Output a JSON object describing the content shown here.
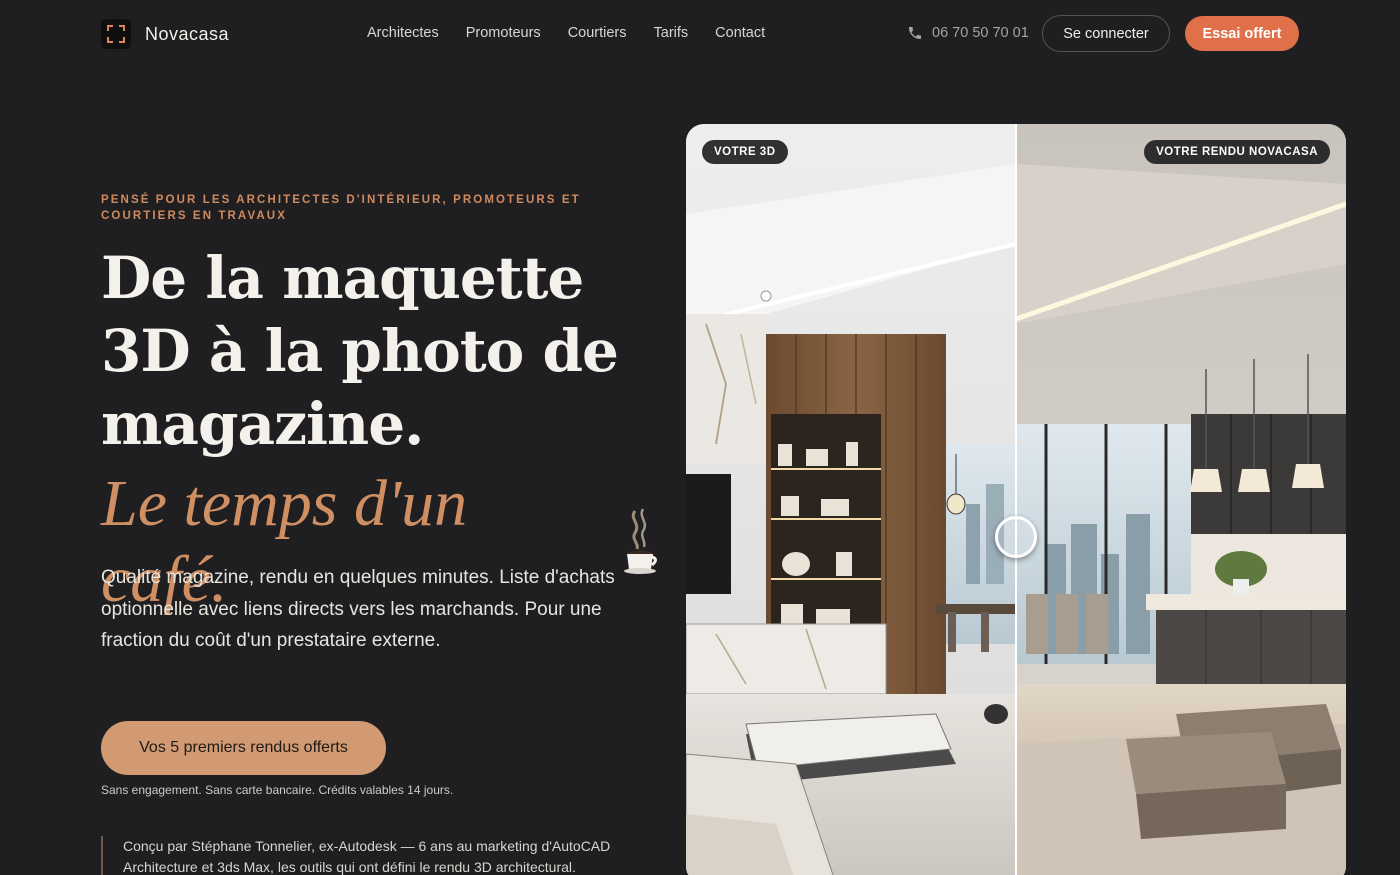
{
  "nav": {
    "brand": "Novacasa",
    "links": [
      "Architectes",
      "Promoteurs",
      "Courtiers",
      "Tarifs",
      "Contact"
    ],
    "phone": "06 70 50 70 01",
    "login_label": "Se connecter",
    "trial_label": "Essai offert"
  },
  "hero": {
    "eyebrow": "Pensé pour les architectes d'intérieur, promoteurs et courtiers en travaux",
    "headline": "De la maquette 3D à la photo de magazine.",
    "headline_accent": "Le temps d'un café.",
    "lead": "Qualité magazine, rendu en quelques minutes. Liste d'achats optionnelle avec liens directs vers les marchands. Pour une fraction du coût d'un prestataire externe.",
    "cta_label": "Vos 5 premiers rendus offerts",
    "fine_print": "Sans engagement. Sans carte bancaire. Crédits valables 14 jours.",
    "quote": "Conçu par Stéphane Tonnelier, ex-Autodesk — 6 ans au marketing d'AutoCAD Architecture et 3ds Max, les outils qui ont défini le rendu 3D architectural."
  },
  "compare": {
    "left_badge": "VOTRE 3D",
    "right_badge": "VOTRE RENDU NOVACASA",
    "slider_position": 0.5
  },
  "colors": {
    "background": "#1f1f21",
    "accent": "#cf8f63",
    "trial_button": "#e0704a",
    "cta_button": "#d29a72"
  }
}
